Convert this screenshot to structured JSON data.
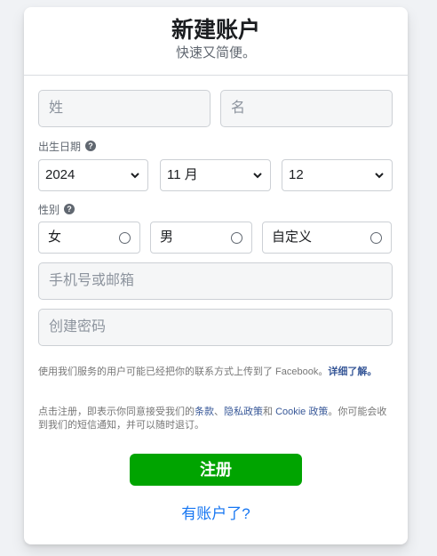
{
  "header": {
    "title": "新建账户",
    "subtitle": "快速又简便。"
  },
  "name": {
    "last_placeholder": "姓",
    "first_placeholder": "名"
  },
  "birthday": {
    "label": "出生日期",
    "year": "2024",
    "month": "11 月",
    "day": "12"
  },
  "gender": {
    "label": "性别",
    "options": [
      "女",
      "男",
      "自定义"
    ]
  },
  "contact_placeholder": "手机号或邮箱",
  "password_placeholder": "创建密码",
  "notes": {
    "upload_text": "使用我们服务的用户可能已经把你的联系方式上传到了 Facebook。",
    "upload_link": "详细了解。",
    "terms_prefix": "点击注册，即表示你同意接受我们的",
    "terms_link": "条款",
    "sep1": "、",
    "privacy_link": "隐私政策",
    "and": "和 ",
    "cookie_link": "Cookie 政策",
    "terms_suffix": "。你可能会收到我们的短信通知，并可以随时退订。"
  },
  "signup_label": "注册",
  "login_link": "有账户了?",
  "colors": {
    "primary_button": "#00a400",
    "link": "#1877f2",
    "text_link": "#385898"
  }
}
